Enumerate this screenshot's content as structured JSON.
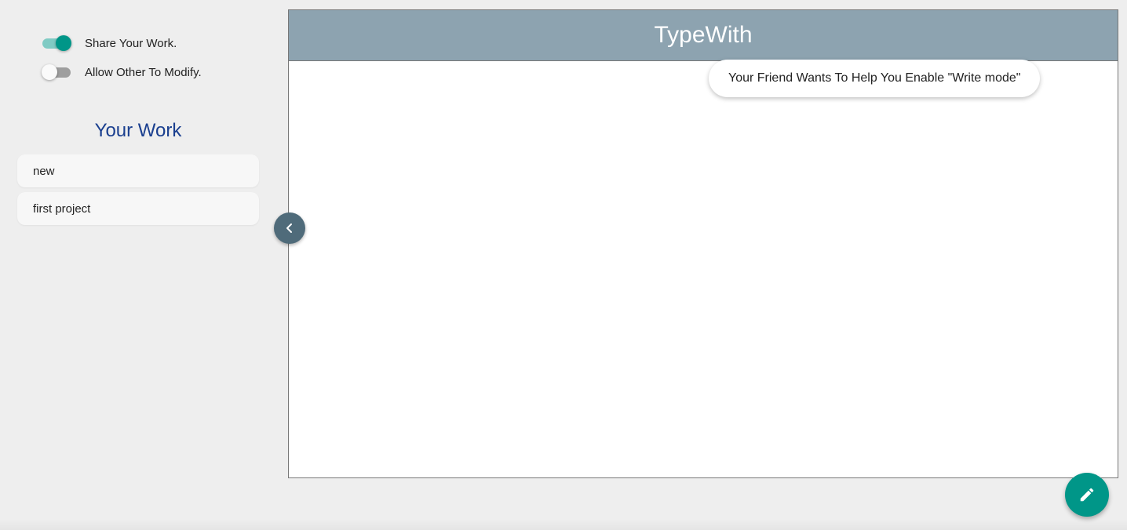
{
  "settings": {
    "share_work": {
      "label": "Share Your Work.",
      "enabled": true
    },
    "allow_modify": {
      "label": "Allow Other To Modify.",
      "enabled": false
    }
  },
  "sidebar": {
    "title": "Your Work",
    "items": [
      {
        "label": "new"
      },
      {
        "label": "first project"
      }
    ]
  },
  "editor": {
    "title": "TypeWith",
    "content": ""
  },
  "toast": {
    "message": "Your Friend Wants To Help You Enable \"Write mode\""
  },
  "icons": {
    "collapse": "chevron-left-icon",
    "fab": "pencil-icon"
  },
  "colors": {
    "accent": "#009688",
    "header": "#8da3b0",
    "title_blue": "#1a3f8f",
    "collapse_button": "#4f6b7a"
  }
}
